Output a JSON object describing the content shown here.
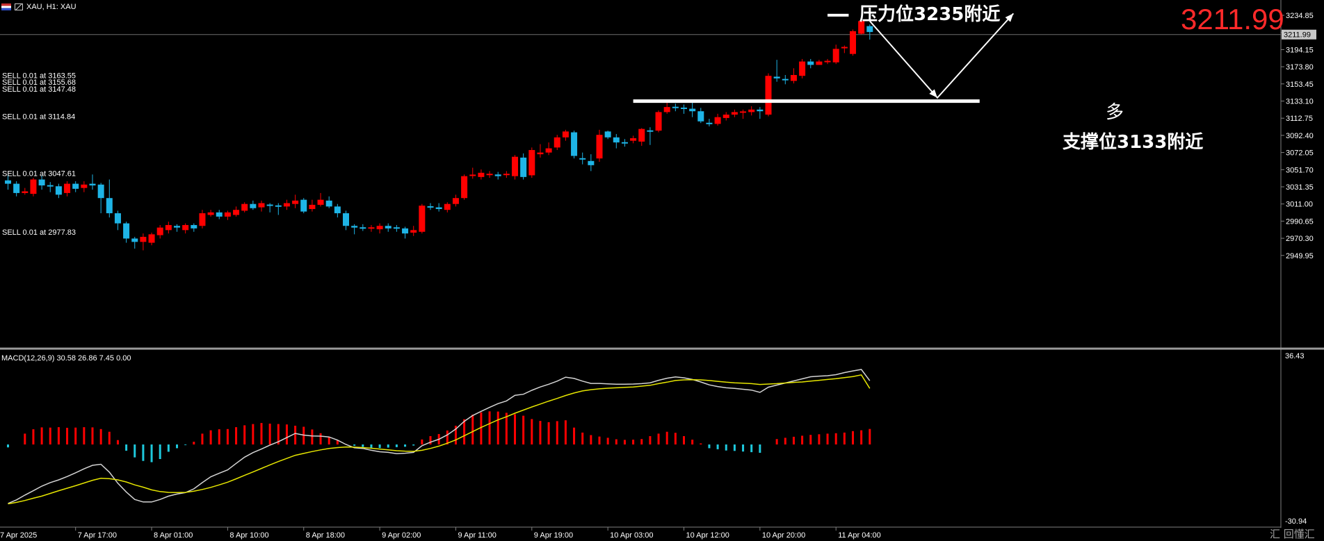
{
  "header": {
    "symbol_text": "XAU, H1:  XAU",
    "flag_icon": "flag-icon",
    "chart_icon": "chart-type-icon"
  },
  "watermark": "汇 回懂汇",
  "annotations": {
    "resistance_text": "压力位3235附近",
    "support_text": "支撑位3133附近",
    "long_text": "多",
    "current_price_big": "3211.99",
    "resistance_level": 3235,
    "support_level": 3133,
    "forecast_path": [
      [
        0,
        3228
      ],
      [
        8,
        3137
      ],
      [
        17,
        3237
      ]
    ]
  },
  "colors": {
    "bull": "#ff0000",
    "bear": "#1eb4e6",
    "macd_line": "#d4d4d4",
    "signal_line": "#e6e600",
    "hist_pos": "#ff0000",
    "hist_neg": "#1ec8dc",
    "price_big": "#ff2a2a"
  },
  "chart_data": {
    "type": "candlestick",
    "price_axis": {
      "ticks": [
        "3234.85",
        "3214.50",
        "3194.15",
        "3173.80",
        "3153.45",
        "3133.10",
        "3112.75",
        "3092.40",
        "3072.05",
        "3051.70",
        "3031.35",
        "3011.00",
        "2990.65",
        "2970.30",
        "2949.95"
      ],
      "range": [
        2930,
        3260
      ],
      "current_label": "3211.99",
      "current_value": 3211.99
    },
    "macd_axis": {
      "top_label": "36.43",
      "bottom_label": "-30.94"
    },
    "time_labels": [
      {
        "i": -1,
        "text": "7 Apr 2025"
      },
      {
        "i": 8,
        "text": "7 Apr 17:00"
      },
      {
        "i": 17,
        "text": "8 Apr 01:00"
      },
      {
        "i": 26,
        "text": "8 Apr 10:00"
      },
      {
        "i": 35,
        "text": "8 Apr 18:00"
      },
      {
        "i": 44,
        "text": "9 Apr 02:00"
      },
      {
        "i": 53,
        "text": "9 Apr 11:00"
      },
      {
        "i": 62,
        "text": "9 Apr 19:00"
      },
      {
        "i": 71,
        "text": "10 Apr 03:00"
      },
      {
        "i": 80,
        "text": "10 Apr 12:00"
      },
      {
        "i": 89,
        "text": "10 Apr 20:00"
      },
      {
        "i": 98,
        "text": "11 Apr 04:00"
      }
    ],
    "trade_labels": [
      {
        "text": "SELL 0.01 at 3163.55",
        "price": 3163.55
      },
      {
        "text": "SELL 0.01 at 3155.68",
        "price": 3155.68
      },
      {
        "text": "SELL 0.01 at 3147.48",
        "price": 3147.48
      },
      {
        "text": "SELL 0.01 at 3114.84",
        "price": 3114.84
      },
      {
        "text": "SELL 0.01 at 3047.61",
        "price": 3047.61
      },
      {
        "text": "SELL 0.01 at 2977.83",
        "price": 2977.83
      }
    ],
    "macd_title": "MACD(12,26,9) 30.58 26.86 7.45 0.00",
    "candles": [
      [
        3039,
        3035,
        3046,
        3028
      ],
      [
        3035,
        3024,
        3038,
        3020
      ],
      [
        3024,
        3026,
        3030,
        3022
      ],
      [
        3023,
        3040,
        3042,
        3020
      ],
      [
        3040,
        3033,
        3045,
        3028
      ],
      [
        3033,
        3032,
        3037,
        3025
      ],
      [
        3032,
        3022,
        3035,
        3018
      ],
      [
        3024,
        3035,
        3038,
        3020
      ],
      [
        3035,
        3029,
        3038,
        3025
      ],
      [
        3030,
        3034,
        3038,
        3025
      ],
      [
        3035,
        3033,
        3046,
        3028
      ],
      [
        3034,
        3018,
        3036,
        3000
      ],
      [
        3018,
        3000,
        3040,
        2995
      ],
      [
        3000,
        2988,
        3003,
        2980
      ],
      [
        2988,
        2970,
        2990,
        2965
      ],
      [
        2970,
        2966,
        2972,
        2958
      ],
      [
        2966,
        2972,
        2976,
        2956
      ],
      [
        2965,
        2975,
        2977,
        2962
      ],
      [
        2974,
        2983,
        2986,
        2970
      ],
      [
        2980,
        2986,
        2990,
        2976
      ],
      [
        2985,
        2983,
        2987,
        2978
      ],
      [
        2980,
        2986,
        2988,
        2976
      ],
      [
        2986,
        2982,
        2988,
        2978
      ],
      [
        2985,
        3000,
        3004,
        2982
      ],
      [
        2998,
        3001,
        3004,
        2996
      ],
      [
        3001,
        2996,
        3004,
        2993
      ],
      [
        2996,
        3001,
        3003,
        2992
      ],
      [
        2998,
        3004,
        3008,
        2996
      ],
      [
        3003,
        3011,
        3013,
        3001
      ],
      [
        3011,
        3006,
        3015,
        3004
      ],
      [
        3007,
        3012,
        3015,
        3002
      ],
      [
        3010,
        3009,
        3012,
        3001
      ],
      [
        3009,
        3008,
        3012,
        2998
      ],
      [
        3008,
        3012,
        3016,
        3004
      ],
      [
        3011,
        3015,
        3022,
        3006
      ],
      [
        3016,
        3002,
        3018,
        3000
      ],
      [
        3005,
        3010,
        3016,
        3002
      ],
      [
        3010,
        3016,
        3024,
        3008
      ],
      [
        3015,
        3008,
        3020,
        3006
      ],
      [
        3008,
        3000,
        3011,
        2995
      ],
      [
        3000,
        2985,
        3003,
        2980
      ],
      [
        2985,
        2983,
        2987,
        2975
      ],
      [
        2983,
        2982,
        2987,
        2979
      ],
      [
        2982,
        2983,
        2986,
        2978
      ],
      [
        2981,
        2985,
        2988,
        2976
      ],
      [
        2985,
        2982,
        2988,
        2978
      ],
      [
        2983,
        2982,
        2986,
        2978
      ],
      [
        2982,
        2976,
        2984,
        2970
      ],
      [
        2977,
        2980,
        2985,
        2973
      ],
      [
        2978,
        3009,
        3011,
        2976
      ],
      [
        3008,
        3007,
        3012,
        3004
      ],
      [
        3007,
        3005,
        3012,
        3002
      ],
      [
        3004,
        3011,
        3013,
        3001
      ],
      [
        3011,
        3018,
        3022,
        3008
      ],
      [
        3018,
        3044,
        3046,
        3016
      ],
      [
        3045,
        3045,
        3054,
        3041
      ],
      [
        3043,
        3048,
        3052,
        3040
      ],
      [
        3046,
        3046,
        3050,
        3042
      ],
      [
        3046,
        3044,
        3049,
        3040
      ],
      [
        3046,
        3046,
        3050,
        3042
      ],
      [
        3044,
        3067,
        3069,
        3040
      ],
      [
        3066,
        3043,
        3071,
        3040
      ],
      [
        3045,
        3075,
        3078,
        3042
      ],
      [
        3070,
        3072,
        3082,
        3066
      ],
      [
        3072,
        3077,
        3084,
        3069
      ],
      [
        3078,
        3090,
        3093,
        3075
      ],
      [
        3090,
        3097,
        3099,
        3086
      ],
      [
        3096,
        3068,
        3098,
        3065
      ],
      [
        3065,
        3064,
        3072,
        3058
      ],
      [
        3062,
        3057,
        3070,
        3050
      ],
      [
        3065,
        3093,
        3099,
        3061
      ],
      [
        3097,
        3090,
        3098,
        3088
      ],
      [
        3090,
        3084,
        3094,
        3077
      ],
      [
        3084,
        3083,
        3088,
        3079
      ],
      [
        3086,
        3089,
        3092,
        3083
      ],
      [
        3085,
        3100,
        3101,
        3080
      ],
      [
        3098,
        3097,
        3102,
        3081
      ],
      [
        3098,
        3120,
        3122,
        3096
      ],
      [
        3120,
        3126,
        3131,
        3118
      ],
      [
        3126,
        3125,
        3130,
        3121
      ],
      [
        3125,
        3124,
        3129,
        3118
      ],
      [
        3124,
        3121,
        3131,
        3114
      ],
      [
        3121,
        3109,
        3125,
        3107
      ],
      [
        3107,
        3106,
        3112,
        3103
      ],
      [
        3106,
        3114,
        3118,
        3104
      ],
      [
        3113,
        3117,
        3120,
        3110
      ],
      [
        3117,
        3120,
        3123,
        3114
      ],
      [
        3120,
        3120,
        3123,
        3112
      ],
      [
        3120,
        3123,
        3127,
        3116
      ],
      [
        3123,
        3121,
        3126,
        3112
      ],
      [
        3117,
        3163,
        3166,
        3115
      ],
      [
        3162,
        3160,
        3182,
        3156
      ],
      [
        3159,
        3158,
        3164,
        3153
      ],
      [
        3157,
        3164,
        3172,
        3154
      ],
      [
        3163,
        3180,
        3183,
        3160
      ],
      [
        3180,
        3176,
        3183,
        3172
      ],
      [
        3176,
        3180,
        3182,
        3176
      ],
      [
        3180,
        3180,
        3183,
        3177
      ],
      [
        3179,
        3195,
        3200,
        3177
      ],
      [
        3196,
        3197,
        3199,
        3190
      ],
      [
        3189,
        3216,
        3218,
        3187
      ],
      [
        3213,
        3228,
        3233,
        3212
      ],
      [
        3222,
        3215,
        3224,
        3206
      ]
    ],
    "macd_fast": [
      -28.3,
      -26.6,
      -24.3,
      -22.2,
      -20.0,
      -18.3,
      -17.0,
      -15.4,
      -13.6,
      -11.7,
      -10.0,
      -9.5,
      -13.3,
      -18.6,
      -22.8,
      -26.4,
      -27.6,
      -27.6,
      -26.4,
      -24.8,
      -23.8,
      -23.1,
      -21.3,
      -18.3,
      -15.5,
      -13.8,
      -12.2,
      -9.1,
      -6.1,
      -3.9,
      -2.2,
      -0.3,
      1.3,
      3.3,
      5.3,
      4.5,
      4.1,
      4.0,
      3.6,
      2.1,
      0.0,
      -1.6,
      -1.9,
      -2.8,
      -3.5,
      -3.8,
      -4.4,
      -4.2,
      -3.8,
      -0.6,
      1.1,
      2.5,
      4.6,
      7.4,
      11.1,
      13.9,
      15.9,
      17.8,
      19.6,
      20.9,
      23.6,
      24.1,
      26.0,
      27.6,
      28.9,
      30.4,
      32.3,
      31.7,
      30.4,
      29.3,
      29.3,
      29.1,
      28.9,
      28.9,
      29.0,
      29.2,
      29.6,
      30.8,
      31.8,
      32.4,
      32.0,
      31.2,
      30.0,
      28.6,
      27.8,
      27.2,
      26.9,
      26.5,
      26.1,
      25.0,
      27.5,
      28.5,
      29.5,
      30.5,
      31.5,
      32.5,
      32.8,
      33.0,
      33.5,
      34.5,
      35.3,
      36.0,
      30.6
    ],
    "macd_signal": [
      -28.5,
      -27.8,
      -26.9,
      -25.8,
      -24.8,
      -23.5,
      -22.2,
      -21.0,
      -19.8,
      -18.5,
      -17.2,
      -16.2,
      -16.4,
      -17.0,
      -18.0,
      -19.4,
      -20.5,
      -21.8,
      -22.6,
      -23.0,
      -23.1,
      -23.0,
      -22.4,
      -21.6,
      -20.6,
      -19.4,
      -18.1,
      -16.5,
      -14.8,
      -13.2,
      -11.5,
      -9.8,
      -8.2,
      -6.7,
      -5.2,
      -4.3,
      -3.4,
      -2.6,
      -1.9,
      -1.5,
      -1.2,
      -1.3,
      -1.5,
      -1.8,
      -2.2,
      -2.6,
      -3.0,
      -3.2,
      -3.3,
      -2.8,
      -1.9,
      -0.8,
      0.6,
      2.2,
      4.2,
      6.2,
      8.2,
      10.0,
      11.8,
      13.3,
      15.0,
      16.5,
      18.0,
      19.4,
      20.8,
      22.1,
      23.5,
      24.7,
      25.7,
      26.3,
      26.7,
      27.0,
      27.2,
      27.4,
      27.6,
      28.0,
      28.4,
      29.2,
      29.9,
      30.7,
      31.0,
      31.1,
      31.0,
      30.7,
      30.3,
      29.9,
      29.6,
      29.4,
      29.2,
      28.8,
      29.0,
      29.2,
      29.5,
      29.8,
      30.0,
      30.4,
      30.8,
      31.2,
      31.6,
      32.1,
      32.6,
      33.4,
      26.9
    ],
    "macd_hist": [
      -1.4,
      0,
      5.2,
      7.3,
      8.2,
      8.1,
      8.3,
      8.0,
      8.1,
      8.3,
      8.2,
      7.4,
      6.1,
      2.1,
      -3.0,
      -6.2,
      -7.9,
      -8.5,
      -7.0,
      -3.5,
      -1.8,
      -0.3,
      1.3,
      5.2,
      6.8,
      7.3,
      7.4,
      8.3,
      9.2,
      9.8,
      10.3,
      10.0,
      9.8,
      9.6,
      9.0,
      8.5,
      7.2,
      5.4,
      3.6,
      2.0,
      0.2,
      -0.6,
      -1.2,
      -1.6,
      -1.7,
      -1.5,
      -1.3,
      -1.1,
      -0.5,
      2.4,
      4.0,
      5.0,
      6.7,
      9.0,
      12.1,
      14.3,
      15.4,
      15.9,
      15.8,
      15.2,
      14.5,
      13.8,
      12.2,
      11.3,
      10.7,
      11.2,
      11.6,
      8.1,
      5.7,
      4.5,
      3.8,
      3.2,
      2.5,
      2.2,
      2.3,
      2.6,
      4.0,
      5.2,
      6.1,
      5.6,
      4.0,
      2.3,
      0.5,
      -1.8,
      -2.3,
      -2.9,
      -3.1,
      -3.4,
      -3.7,
      -4.0,
      0,
      2.6,
      3.2,
      3.7,
      4.2,
      4.6,
      4.9,
      5.2,
      5.4,
      5.7,
      6.4,
      6.8,
      7.45
    ]
  }
}
